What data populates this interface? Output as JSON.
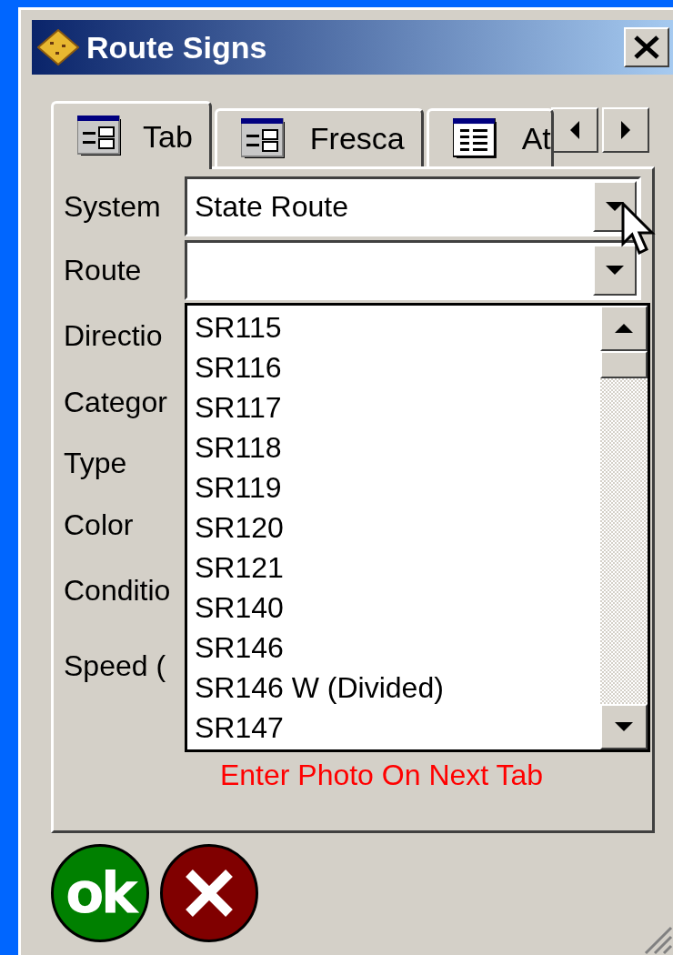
{
  "window": {
    "title": "Route Signs"
  },
  "tabs": [
    {
      "label": "Tab",
      "selected": true,
      "kind": "form"
    },
    {
      "label": "Fresca",
      "selected": false,
      "kind": "form"
    },
    {
      "label": "At",
      "selected": false,
      "kind": "list"
    }
  ],
  "fields": [
    {
      "label": "System",
      "value": "State Route"
    },
    {
      "label": "Route"
    }
  ],
  "labels": [
    "Directio",
    "Categor",
    "Type",
    "Color",
    "Conditio",
    "Speed ("
  ],
  "dropdown": {
    "items": [
      "SR115",
      "SR116",
      "SR117",
      "SR118",
      "SR119",
      "SR120",
      "SR121",
      "SR140",
      "SR146",
      "SR146 W (Divided)",
      "SR147"
    ]
  },
  "note": "Enter Photo On Next Tab",
  "ok_button": {
    "label": "ok"
  }
}
